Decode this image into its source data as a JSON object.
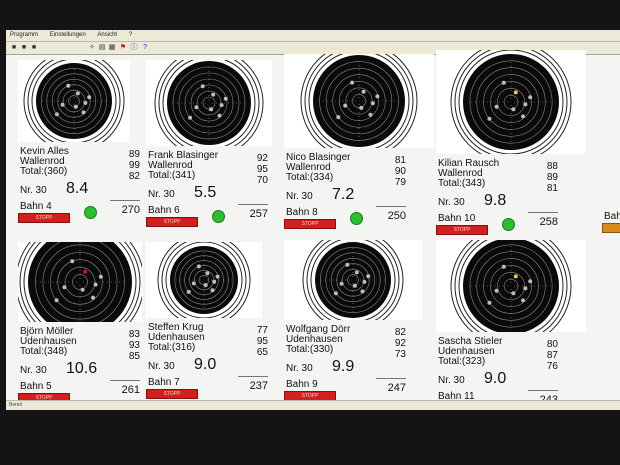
{
  "menu": {
    "items": [
      "Programm",
      "Einstellungen",
      "Ansicht",
      "?"
    ]
  },
  "toolbar": {
    "icons": [
      "folder-icon",
      "tool-icon",
      "print-icon",
      "flag-icon",
      "info-icon",
      "help-icon"
    ]
  },
  "status": {
    "text": "Bereit"
  },
  "colors": {
    "stop": "#d21f1f",
    "led": "#2ebd2e",
    "partial": "#d98b1e"
  },
  "lanes": [
    {
      "name": "Kevin Alles",
      "club": "Wallenrod",
      "total": "Total:(360)",
      "series": [
        "89",
        "99",
        "82"
      ],
      "shot_nr": "Nr. 30",
      "ring": "8.4",
      "sum": "270",
      "bahn": "Bahn 4",
      "stop": "STOPP",
      "led": true
    },
    {
      "name": "Frank Blasinger",
      "club": "Wallenrod",
      "total": "Total:(341)",
      "series": [
        "92",
        "95",
        "70"
      ],
      "shot_nr": "Nr. 30",
      "ring": "5.5",
      "sum": "257",
      "bahn": "Bahn 6",
      "stop": "STOPP",
      "led": true
    },
    {
      "name": "Nico Blasinger",
      "club": "Wallenrod",
      "total": "Total:(334)",
      "series": [
        "81",
        "90",
        "79"
      ],
      "shot_nr": "Nr. 30",
      "ring": "7.2",
      "sum": "250",
      "bahn": "Bahn 8",
      "stop": "STOPP",
      "led": true
    },
    {
      "name": "Kilian Rausch",
      "club": "Wallenrod",
      "total": "Total:(343)",
      "series": [
        "88",
        "89",
        "81"
      ],
      "shot_nr": "Nr. 30",
      "ring": "9.8",
      "sum": "258",
      "bahn": "Bahn 10",
      "stop": "STOPP",
      "led": true
    },
    {
      "name": "Björn Möller",
      "club": "Udenhausen",
      "total": "Total:(348)",
      "series": [
        "83",
        "93",
        "85"
      ],
      "shot_nr": "Nr. 30",
      "ring": "10.6",
      "sum": "261",
      "bahn": "Bahn 5",
      "stop": "STOPP",
      "led": false
    },
    {
      "name": "Steffen Krug",
      "club": "Udenhausen",
      "total": "Total:(316)",
      "series": [
        "77",
        "95",
        "65"
      ],
      "shot_nr": "Nr. 30",
      "ring": "9.0",
      "sum": "237",
      "bahn": "Bahn 7",
      "stop": "STOPP",
      "led": false
    },
    {
      "name": "Wolfgang Dörr",
      "club": "Udenhausen",
      "total": "Total:(330)",
      "series": [
        "82",
        "92",
        "73"
      ],
      "shot_nr": "Nr. 30",
      "ring": "9.9",
      "sum": "247",
      "bahn": "Bahn 9",
      "stop": "STOPP",
      "led": false
    },
    {
      "name": "Sascha Stieler",
      "club": "Udenhausen",
      "total": "Total:(323)",
      "series": [
        "80",
        "87",
        "76"
      ],
      "shot_nr": "Nr. 30",
      "ring": "9.0",
      "sum": "243",
      "bahn": "Bahn 11",
      "stop": "STOPP",
      "led": false
    }
  ],
  "partial_lane": {
    "bahn": "Bah"
  }
}
